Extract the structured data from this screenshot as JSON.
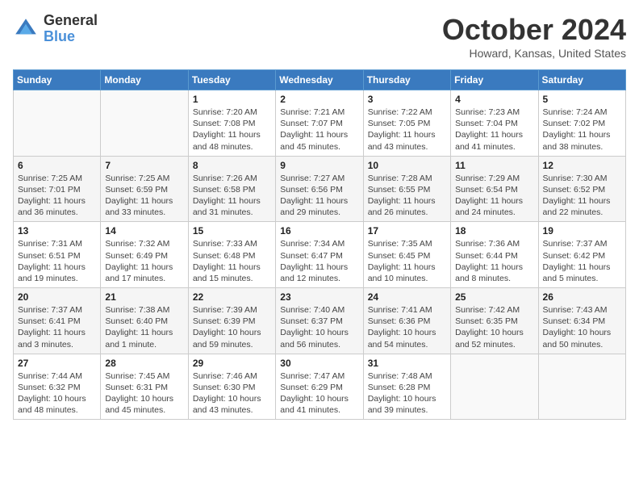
{
  "header": {
    "logo_general": "General",
    "logo_blue": "Blue",
    "month_title": "October 2024",
    "location": "Howard, Kansas, United States"
  },
  "days_of_week": [
    "Sunday",
    "Monday",
    "Tuesday",
    "Wednesday",
    "Thursday",
    "Friday",
    "Saturday"
  ],
  "weeks": [
    [
      {
        "day": "",
        "info": ""
      },
      {
        "day": "",
        "info": ""
      },
      {
        "day": "1",
        "info": "Sunrise: 7:20 AM\nSunset: 7:08 PM\nDaylight: 11 hours and 48 minutes."
      },
      {
        "day": "2",
        "info": "Sunrise: 7:21 AM\nSunset: 7:07 PM\nDaylight: 11 hours and 45 minutes."
      },
      {
        "day": "3",
        "info": "Sunrise: 7:22 AM\nSunset: 7:05 PM\nDaylight: 11 hours and 43 minutes."
      },
      {
        "day": "4",
        "info": "Sunrise: 7:23 AM\nSunset: 7:04 PM\nDaylight: 11 hours and 41 minutes."
      },
      {
        "day": "5",
        "info": "Sunrise: 7:24 AM\nSunset: 7:02 PM\nDaylight: 11 hours and 38 minutes."
      }
    ],
    [
      {
        "day": "6",
        "info": "Sunrise: 7:25 AM\nSunset: 7:01 PM\nDaylight: 11 hours and 36 minutes."
      },
      {
        "day": "7",
        "info": "Sunrise: 7:25 AM\nSunset: 6:59 PM\nDaylight: 11 hours and 33 minutes."
      },
      {
        "day": "8",
        "info": "Sunrise: 7:26 AM\nSunset: 6:58 PM\nDaylight: 11 hours and 31 minutes."
      },
      {
        "day": "9",
        "info": "Sunrise: 7:27 AM\nSunset: 6:56 PM\nDaylight: 11 hours and 29 minutes."
      },
      {
        "day": "10",
        "info": "Sunrise: 7:28 AM\nSunset: 6:55 PM\nDaylight: 11 hours and 26 minutes."
      },
      {
        "day": "11",
        "info": "Sunrise: 7:29 AM\nSunset: 6:54 PM\nDaylight: 11 hours and 24 minutes."
      },
      {
        "day": "12",
        "info": "Sunrise: 7:30 AM\nSunset: 6:52 PM\nDaylight: 11 hours and 22 minutes."
      }
    ],
    [
      {
        "day": "13",
        "info": "Sunrise: 7:31 AM\nSunset: 6:51 PM\nDaylight: 11 hours and 19 minutes."
      },
      {
        "day": "14",
        "info": "Sunrise: 7:32 AM\nSunset: 6:49 PM\nDaylight: 11 hours and 17 minutes."
      },
      {
        "day": "15",
        "info": "Sunrise: 7:33 AM\nSunset: 6:48 PM\nDaylight: 11 hours and 15 minutes."
      },
      {
        "day": "16",
        "info": "Sunrise: 7:34 AM\nSunset: 6:47 PM\nDaylight: 11 hours and 12 minutes."
      },
      {
        "day": "17",
        "info": "Sunrise: 7:35 AM\nSunset: 6:45 PM\nDaylight: 11 hours and 10 minutes."
      },
      {
        "day": "18",
        "info": "Sunrise: 7:36 AM\nSunset: 6:44 PM\nDaylight: 11 hours and 8 minutes."
      },
      {
        "day": "19",
        "info": "Sunrise: 7:37 AM\nSunset: 6:42 PM\nDaylight: 11 hours and 5 minutes."
      }
    ],
    [
      {
        "day": "20",
        "info": "Sunrise: 7:37 AM\nSunset: 6:41 PM\nDaylight: 11 hours and 3 minutes."
      },
      {
        "day": "21",
        "info": "Sunrise: 7:38 AM\nSunset: 6:40 PM\nDaylight: 11 hours and 1 minute."
      },
      {
        "day": "22",
        "info": "Sunrise: 7:39 AM\nSunset: 6:39 PM\nDaylight: 10 hours and 59 minutes."
      },
      {
        "day": "23",
        "info": "Sunrise: 7:40 AM\nSunset: 6:37 PM\nDaylight: 10 hours and 56 minutes."
      },
      {
        "day": "24",
        "info": "Sunrise: 7:41 AM\nSunset: 6:36 PM\nDaylight: 10 hours and 54 minutes."
      },
      {
        "day": "25",
        "info": "Sunrise: 7:42 AM\nSunset: 6:35 PM\nDaylight: 10 hours and 52 minutes."
      },
      {
        "day": "26",
        "info": "Sunrise: 7:43 AM\nSunset: 6:34 PM\nDaylight: 10 hours and 50 minutes."
      }
    ],
    [
      {
        "day": "27",
        "info": "Sunrise: 7:44 AM\nSunset: 6:32 PM\nDaylight: 10 hours and 48 minutes."
      },
      {
        "day": "28",
        "info": "Sunrise: 7:45 AM\nSunset: 6:31 PM\nDaylight: 10 hours and 45 minutes."
      },
      {
        "day": "29",
        "info": "Sunrise: 7:46 AM\nSunset: 6:30 PM\nDaylight: 10 hours and 43 minutes."
      },
      {
        "day": "30",
        "info": "Sunrise: 7:47 AM\nSunset: 6:29 PM\nDaylight: 10 hours and 41 minutes."
      },
      {
        "day": "31",
        "info": "Sunrise: 7:48 AM\nSunset: 6:28 PM\nDaylight: 10 hours and 39 minutes."
      },
      {
        "day": "",
        "info": ""
      },
      {
        "day": "",
        "info": ""
      }
    ]
  ]
}
